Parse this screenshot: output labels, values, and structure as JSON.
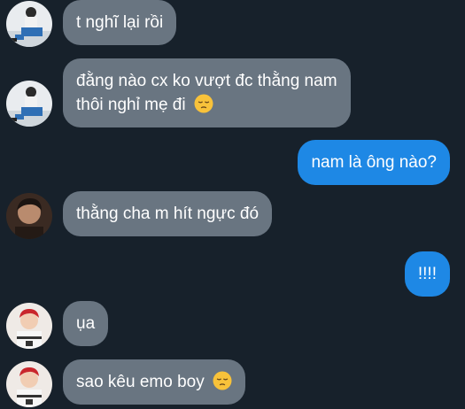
{
  "colors": {
    "background": "#17212b",
    "incoming_bubble": "#697581",
    "outgoing_bubble": "#1e88e5",
    "text": "#ffffff"
  },
  "messages": [
    {
      "direction": "incoming",
      "avatar": "avatar-boy-blue-jeans",
      "lines": [
        "t nghĩ lại rồi"
      ]
    },
    {
      "direction": "incoming",
      "avatar": "avatar-boy-blue-jeans",
      "lines": [
        "đằng nào cx ko vượt đc thằng nam",
        "thôi nghỉ mẹ đi"
      ],
      "emoji": "pensive-face-emoji"
    },
    {
      "direction": "outgoing",
      "lines": [
        "nam là ông nào?"
      ]
    },
    {
      "direction": "incoming",
      "avatar": "avatar-dark-portrait",
      "lines": [
        "thằng cha m hít ngực đó"
      ]
    },
    {
      "direction": "outgoing",
      "lines": [
        "!!!!"
      ]
    },
    {
      "direction": "incoming",
      "avatar": "avatar-red-hair",
      "lines": [
        "ụa"
      ]
    },
    {
      "direction": "incoming",
      "avatar": "avatar-red-hair",
      "lines": [
        "sao kêu emo boy"
      ],
      "emoji": "pensive-face-emoji"
    }
  ]
}
